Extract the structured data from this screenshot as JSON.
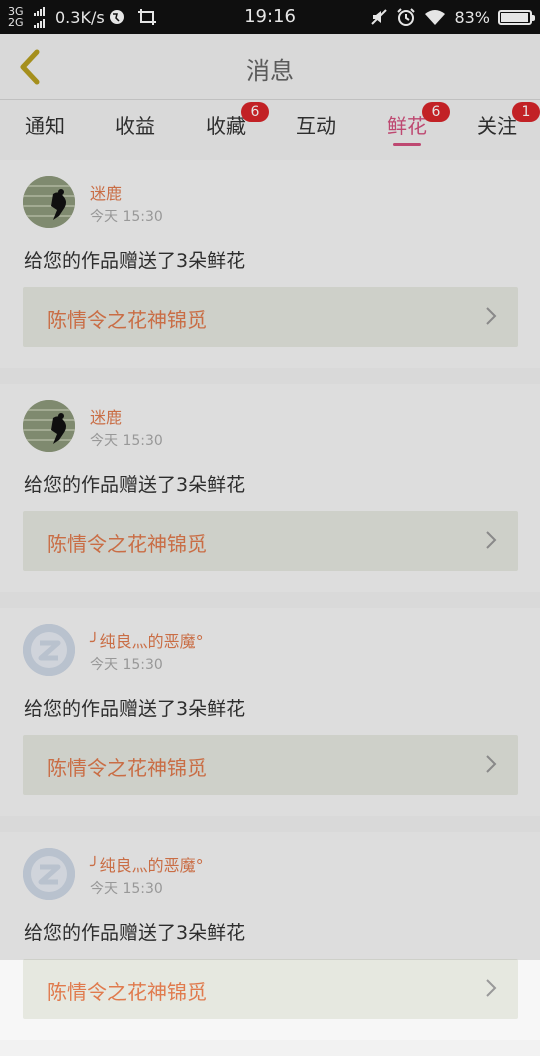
{
  "status_bar": {
    "network_top": "3G",
    "network_bottom": "2G",
    "speed": "0.3K/s",
    "time": "19:16",
    "battery": "83%"
  },
  "header": {
    "title": "消息"
  },
  "tabs": [
    {
      "label": "通知",
      "badge": ""
    },
    {
      "label": "收益",
      "badge": ""
    },
    {
      "label": "收藏",
      "badge": "6"
    },
    {
      "label": "互动",
      "badge": ""
    },
    {
      "label": "鲜花",
      "badge": "6",
      "active": true
    },
    {
      "label": "关注",
      "badge": "1"
    }
  ],
  "messages": [
    {
      "username": "迷鹿",
      "time": "今天 15:30",
      "text": "给您的作品赠送了3朵鲜花",
      "work_title": "陈情令之花神锦觅",
      "avatar": "photo"
    },
    {
      "username": "迷鹿",
      "time": "今天 15:30",
      "text": "给您的作品赠送了3朵鲜花",
      "work_title": "陈情令之花神锦觅",
      "avatar": "photo"
    },
    {
      "username": "╯纯良灬的恶魔°",
      "time": "今天 15:30",
      "text": "给您的作品赠送了3朵鲜花",
      "work_title": "陈情令之花神锦觅",
      "avatar": "default"
    },
    {
      "username": "╯纯良灬的恶魔°",
      "time": "今天 15:30",
      "text": "给您的作品赠送了3朵鲜花",
      "work_title": "陈情令之花神锦觅",
      "avatar": "default"
    }
  ],
  "colors": {
    "accent": "#d4517e",
    "username": "#e07a4d",
    "badge": "#d9252a",
    "back_arrow": "#b8a020"
  }
}
